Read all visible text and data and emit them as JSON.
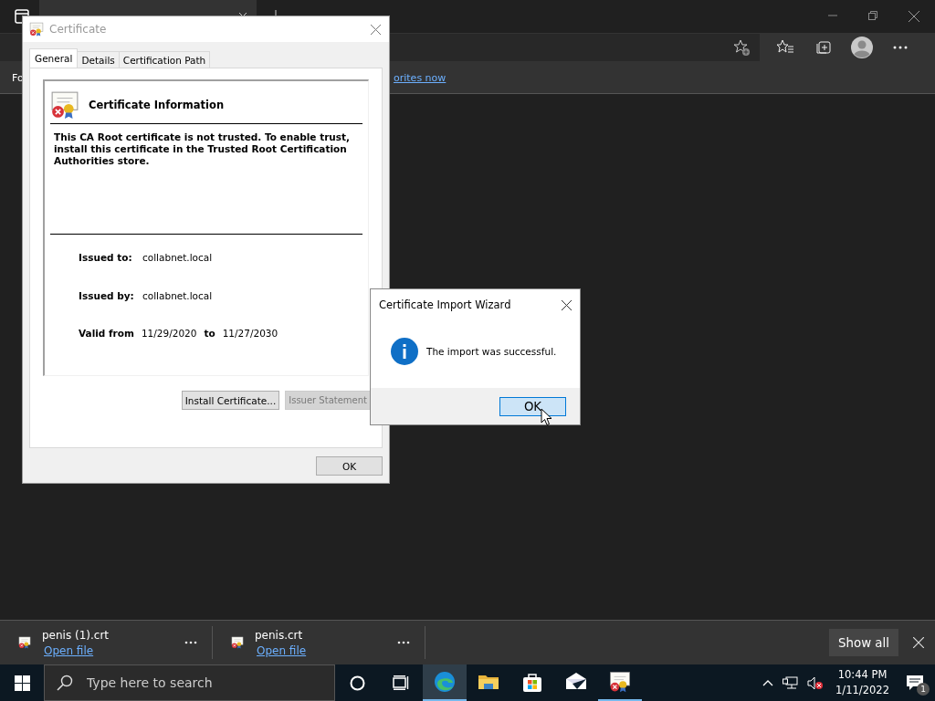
{
  "browser": {
    "favorites_bar": {
      "text": "Fo",
      "link": "orites now"
    }
  },
  "certificate_dialog": {
    "title": "Certificate",
    "tabs": [
      {
        "label": "General",
        "selected": true
      },
      {
        "label": "Details",
        "selected": false
      },
      {
        "label": "Certification Path",
        "selected": false
      }
    ],
    "heading": "Certificate Information",
    "message": "This CA Root certificate is not trusted. To enable trust, install this certificate in the Trusted Root Certification Authorities store.",
    "fields": [
      {
        "label": "Issued to:",
        "value": "collabnet.local"
      },
      {
        "label": "Issued by:",
        "value": "collabnet.local"
      }
    ],
    "validity": {
      "from_label": "Valid from",
      "from": "11/29/2020",
      "to_label": "to",
      "to": "11/27/2030"
    },
    "buttons": [
      {
        "label": "Install Certificate...",
        "disabled": false
      },
      {
        "label": "Issuer Statement",
        "disabled": true
      }
    ],
    "ok_button": "OK"
  },
  "import_wizard": {
    "title": "Certificate Import Wizard",
    "message": "The import was successful.",
    "ok_button": "OK"
  },
  "downloads": {
    "items": [
      {
        "file": "penis (1).crt",
        "action": "Open file"
      },
      {
        "file": "penis.crt",
        "action": "Open file"
      }
    ],
    "show_all": "Show all"
  },
  "taskbar": {
    "search_placeholder": "Type here to search",
    "apps": [
      {
        "kind": "edge",
        "running": true,
        "selected": true
      },
      {
        "kind": "explorer",
        "running": false,
        "selected": false
      },
      {
        "kind": "store",
        "running": false,
        "selected": false
      },
      {
        "kind": "mail",
        "running": false,
        "selected": false
      },
      {
        "kind": "certificate",
        "running": true,
        "selected": false
      }
    ],
    "time": "10:44 PM",
    "date": "1/11/2022",
    "notification_count": "1"
  }
}
